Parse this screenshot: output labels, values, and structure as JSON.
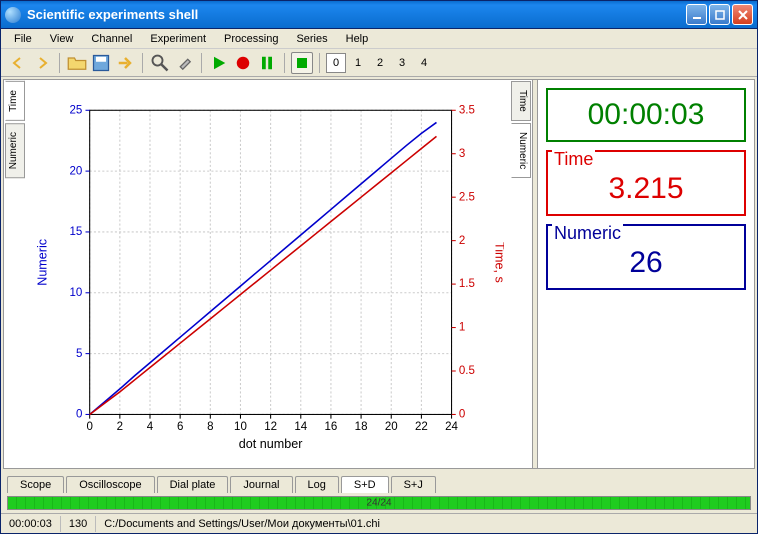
{
  "window": {
    "title": "Scientific experiments shell"
  },
  "menu": {
    "items": [
      "File",
      "View",
      "Channel",
      "Experiment",
      "Processing",
      "Series",
      "Help"
    ]
  },
  "toolbar": {
    "numbers": [
      "0",
      "1",
      "2",
      "3",
      "4"
    ]
  },
  "side_tabs": {
    "left": [
      "Time",
      "Numeric"
    ],
    "right": [
      "Time",
      "Numeric"
    ]
  },
  "readouts": {
    "clock": {
      "value": "00:00:03"
    },
    "time": {
      "label": "Time",
      "value": "3.215"
    },
    "numeric": {
      "label": "Numeric",
      "value": "26"
    }
  },
  "bottom_tabs": [
    "Scope",
    "Oscilloscope",
    "Dial plate",
    "Journal",
    "Log",
    "S+D",
    "S+J"
  ],
  "bottom_tabs_active": "S+D",
  "progress": {
    "label": "24/24",
    "percent": 100
  },
  "status": {
    "elapsed": "00:00:03",
    "count": "130",
    "path": "C:/Documents and Settings/User/Мои документы\\01.chi"
  },
  "chart_data": {
    "type": "line",
    "xlabel": "dot number",
    "ylabel_left": "Numeric",
    "ylabel_right": "Time, s",
    "xlim": [
      0,
      24
    ],
    "ylim_left": [
      0,
      25
    ],
    "ylim_right": [
      0,
      3.5
    ],
    "xticks": [
      0,
      2,
      4,
      6,
      8,
      10,
      12,
      14,
      16,
      18,
      20,
      22,
      24
    ],
    "yticks_left": [
      0,
      5,
      10,
      15,
      20,
      25
    ],
    "yticks_right": [
      0,
      0.5,
      1,
      1.5,
      2,
      2.5,
      3,
      3.5
    ],
    "series": [
      {
        "name": "Numeric",
        "axis": "left",
        "color": "#0000cc",
        "x": [
          0,
          1,
          2,
          3,
          4,
          5,
          6,
          7,
          8,
          9,
          10,
          11,
          12,
          13,
          14,
          15,
          16,
          17,
          18,
          19,
          20,
          21,
          22,
          23
        ],
        "y": [
          0,
          1.05,
          2.1,
          3.2,
          4.25,
          5.3,
          6.35,
          7.4,
          8.45,
          9.5,
          10.55,
          11.6,
          12.65,
          13.7,
          14.75,
          15.8,
          16.85,
          17.9,
          18.95,
          20.0,
          21.05,
          22.1,
          23.1,
          24.0
        ]
      },
      {
        "name": "Time",
        "axis": "right",
        "color": "#cc0000",
        "x": [
          0,
          1,
          2,
          3,
          4,
          5,
          6,
          7,
          8,
          9,
          10,
          11,
          12,
          13,
          14,
          15,
          16,
          17,
          18,
          19,
          20,
          21,
          22,
          23
        ],
        "y": [
          0,
          0.13,
          0.26,
          0.4,
          0.54,
          0.68,
          0.82,
          0.96,
          1.1,
          1.24,
          1.38,
          1.52,
          1.66,
          1.8,
          1.94,
          2.08,
          2.22,
          2.36,
          2.5,
          2.64,
          2.78,
          2.92,
          3.06,
          3.2
        ]
      }
    ]
  }
}
